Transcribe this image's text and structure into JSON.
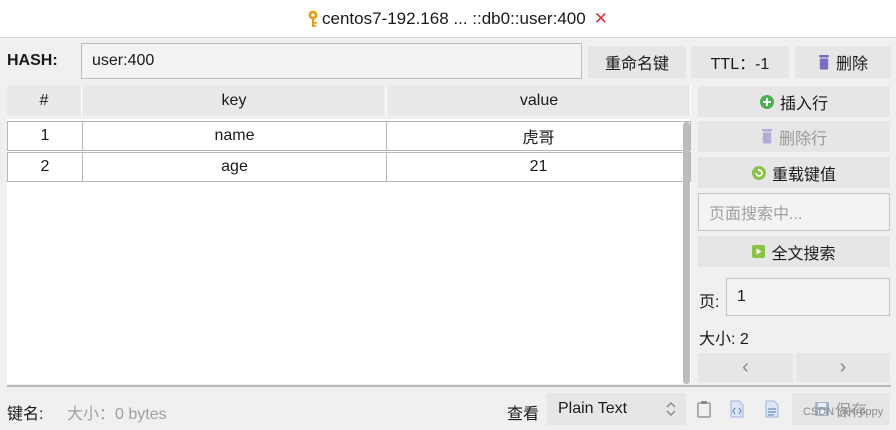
{
  "tab": {
    "title": "centos7-192.168 ... ::db0::user:400",
    "close": "✕"
  },
  "header": {
    "type_label": "HASH:",
    "key_value": "user:400",
    "rename_label": "重命名键",
    "ttl_label": "TTL：-1",
    "delete_label": "删除"
  },
  "table": {
    "columns": [
      "#",
      "key",
      "value"
    ],
    "rows": [
      {
        "index": "1",
        "key": "name",
        "value": "虎哥"
      },
      {
        "index": "2",
        "key": "age",
        "value": "21"
      }
    ]
  },
  "sidebar": {
    "insert_row": "插入行",
    "delete_row": "删除行",
    "reload": "重载键值",
    "page_search_placeholder": "页面搜索中...",
    "fulltext_search": "全文搜索",
    "page_label": "页:",
    "page_value": "1",
    "size_label": "大小:",
    "size_value": "2",
    "prev": "‹",
    "next": "›"
  },
  "footer": {
    "key_name_label": "键名:",
    "size_info": "大小：0 bytes",
    "view_label": "查看",
    "view_mode": "Plain Text",
    "save_label": "保存",
    "watermark": "CSDN @Kroppy"
  },
  "colors": {
    "close_red": "#d9363e",
    "key_gold": "#e0a21b",
    "add_green": "#4caf50",
    "delete_purple": "#7b6bbd"
  }
}
